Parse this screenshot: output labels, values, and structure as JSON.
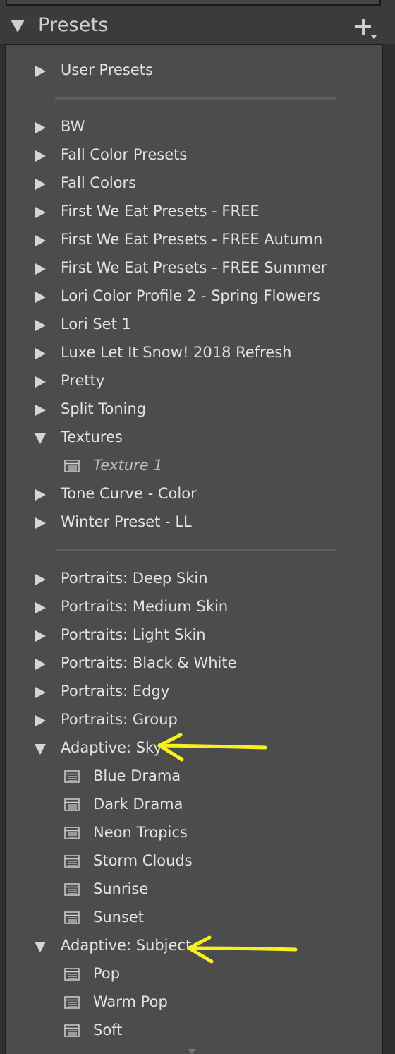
{
  "panel": {
    "title": "Presets",
    "add_icon": "plus-dropdown-icon"
  },
  "groups": {
    "user": {
      "label": "User Presets",
      "state": "collapsed"
    },
    "custom": [
      {
        "label": "BW",
        "state": "collapsed"
      },
      {
        "label": "Fall Color Presets",
        "state": "collapsed"
      },
      {
        "label": "Fall Colors",
        "state": "collapsed"
      },
      {
        "label": "First We Eat Presets - FREE",
        "state": "collapsed"
      },
      {
        "label": "First We Eat Presets - FREE Autumn",
        "state": "collapsed"
      },
      {
        "label": "First We Eat Presets - FREE Summer",
        "state": "collapsed"
      },
      {
        "label": "Lori Color Profile 2 - Spring Flowers",
        "state": "collapsed"
      },
      {
        "label": "Lori Set 1",
        "state": "collapsed"
      },
      {
        "label": "Luxe Let It Snow! 2018 Refresh",
        "state": "collapsed"
      },
      {
        "label": "Pretty",
        "state": "collapsed"
      },
      {
        "label": "Split Toning",
        "state": "collapsed"
      },
      {
        "label": "Textures",
        "state": "expanded",
        "presets": [
          "Texture 1"
        ]
      },
      {
        "label": "Tone Curve - Color",
        "state": "collapsed"
      },
      {
        "label": "Winter Preset  - LL",
        "state": "collapsed"
      }
    ],
    "builtin": [
      {
        "label": "Portraits: Deep Skin",
        "state": "collapsed"
      },
      {
        "label": "Portraits: Medium Skin",
        "state": "collapsed"
      },
      {
        "label": "Portraits: Light Skin",
        "state": "collapsed"
      },
      {
        "label": "Portraits: Black & White",
        "state": "collapsed"
      },
      {
        "label": "Portraits: Edgy",
        "state": "collapsed"
      },
      {
        "label": "Portraits: Group",
        "state": "collapsed"
      },
      {
        "label": "Adaptive: Sky",
        "state": "expanded",
        "presets": [
          "Blue Drama",
          "Dark Drama",
          "Neon Tropics",
          "Storm Clouds",
          "Sunrise",
          "Sunset"
        ]
      },
      {
        "label": "Adaptive: Subject",
        "state": "expanded",
        "presets": [
          "Pop",
          "Warm Pop",
          "Soft"
        ]
      }
    ]
  },
  "annotations": {
    "arrow_color": "#f5f01e",
    "icon": "yellow-arrow-icon"
  },
  "colors": {
    "panel_bg": "#4c4c4c",
    "header_bg": "#3b3b3b",
    "text": "#e3e3e3"
  }
}
